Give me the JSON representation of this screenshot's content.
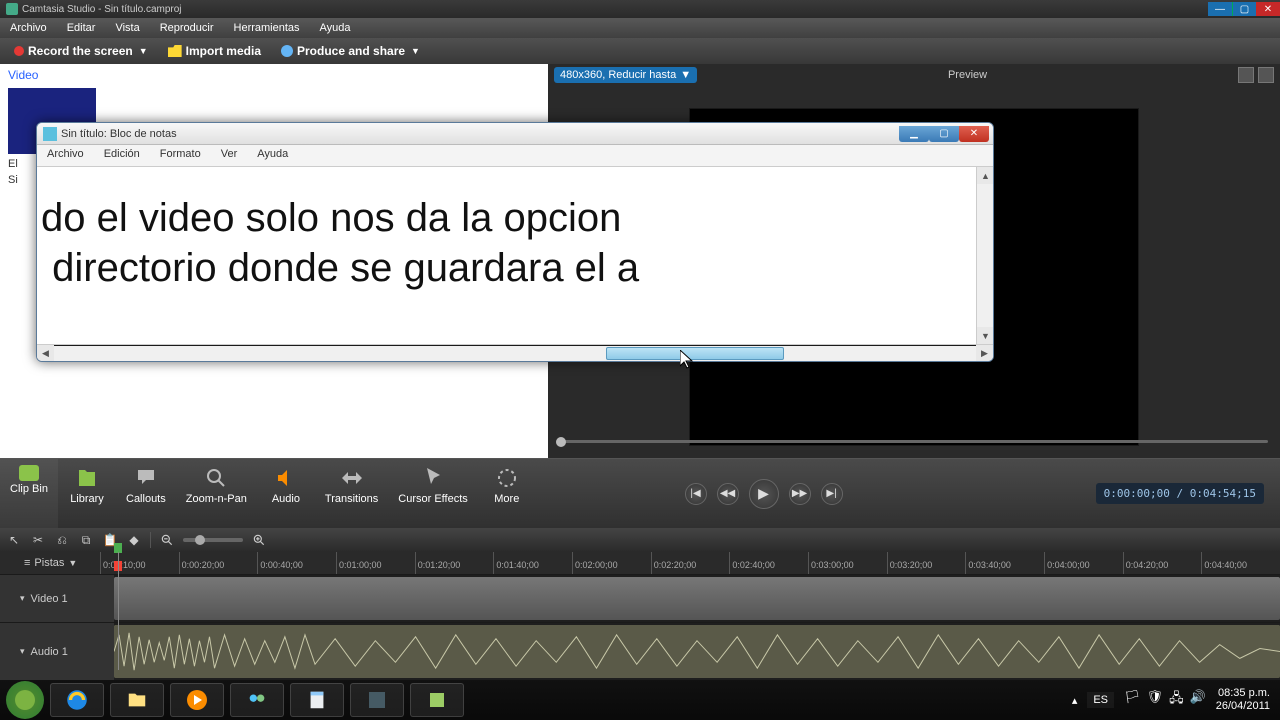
{
  "app": {
    "title": "Camtasia Studio - Sin título.camproj",
    "menubar": [
      "Archivo",
      "Editar",
      "Vista",
      "Reproducir",
      "Herramientas",
      "Ayuda"
    ],
    "toolbar": {
      "record": "Record the screen",
      "import": "Import media",
      "produce": "Produce and share"
    },
    "clipbin_label": "Video",
    "clip_caption_1": "El",
    "clip_caption_2": "Si",
    "preview": {
      "resolution": "480x360, Reducir hasta",
      "title": "Preview"
    },
    "tasktabs": [
      {
        "label": "Clip Bin"
      },
      {
        "label": "Library"
      },
      {
        "label": "Callouts"
      },
      {
        "label": "Zoom-n-Pan"
      },
      {
        "label": "Audio"
      },
      {
        "label": "Transitions"
      },
      {
        "label": "Cursor Effects"
      },
      {
        "label": "More"
      }
    ],
    "timecode": "0:00:00;00 / 0:04:54;15",
    "tracks_label": "Pistas",
    "track_video": "Video 1",
    "track_audio": "Audio 1",
    "ruler": [
      "0:00:10;00",
      "0:00:20;00",
      "0:00:40;00",
      "0:01:00;00",
      "0:01:20;00",
      "0:01:40;00",
      "0:02:00;00",
      "0:02:20;00",
      "0:02:40;00",
      "0:03:00;00",
      "0:03:20;00",
      "0:03:40;00",
      "0:04:00;00",
      "0:04:20;00",
      "0:04:40;00"
    ]
  },
  "notepad": {
    "title": "Sin título: Bloc de notas",
    "menubar": [
      "Archivo",
      "Edición",
      "Formato",
      "Ver",
      "Ayuda"
    ],
    "text_line1": "do el video solo nos da la opcion",
    "text_line2": " directorio donde se guardara el a"
  },
  "taskbar": {
    "lang": "ES",
    "time": "08:35 p.m.",
    "date": "26/04/2011"
  }
}
